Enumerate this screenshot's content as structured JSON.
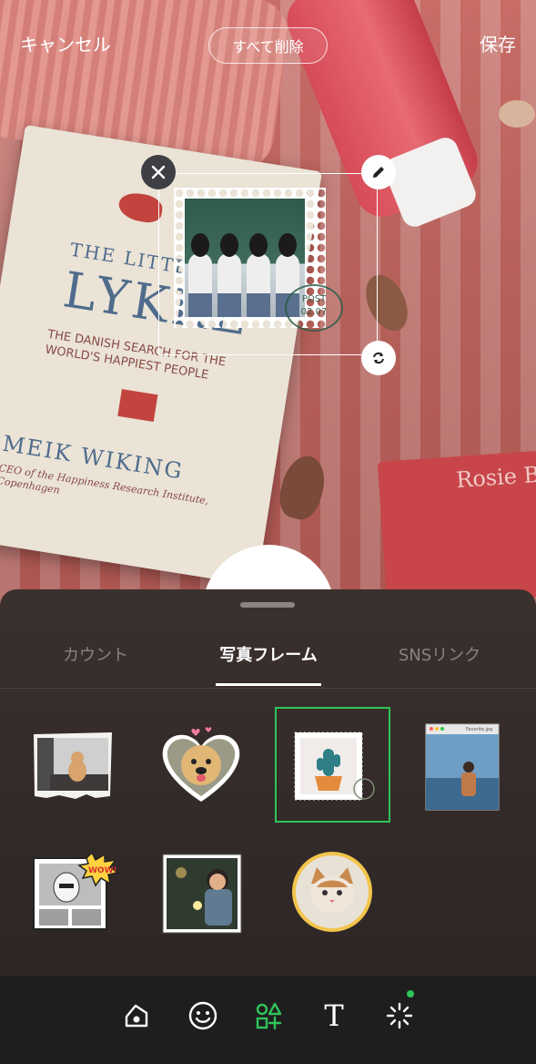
{
  "topbar": {
    "cancel_label": "キャンセル",
    "clear_all_label": "すべて削除",
    "save_label": "保存"
  },
  "background": {
    "book_title_small": "THE LITTLE",
    "book_title_large": "LYKKE",
    "book_subtitle": "THE DANISH SEARCH FOR THE WORLD'S HAPPIEST PEOPLE",
    "book_author": "MEIK WIKING",
    "book_author_note": "CEO of the Happiness Research Institute, Copenhagen",
    "book2_title": "Rosie B"
  },
  "sticker": {
    "postmark_text": "POST",
    "postmark_date": "02.07"
  },
  "tabs": [
    {
      "label": "カウント",
      "active": false
    },
    {
      "label": "写真フレーム",
      "active": true
    },
    {
      "label": "SNSリンク",
      "active": false
    }
  ],
  "frames": [
    {
      "name": "torn-paper-cat",
      "selected": false
    },
    {
      "name": "heart-dog",
      "selected": false
    },
    {
      "name": "stamp-cactus",
      "selected": true
    },
    {
      "name": "window-photo",
      "selected": false,
      "window_title": "Favorite.jpg"
    },
    {
      "name": "comic-wow",
      "selected": false,
      "burst_text": "WOW!"
    },
    {
      "name": "polaroid-boy",
      "selected": false
    },
    {
      "name": "circle-cat",
      "selected": false
    }
  ],
  "toolbar": [
    {
      "icon": "sticker-icon",
      "active": false
    },
    {
      "icon": "emoji-icon",
      "active": false
    },
    {
      "icon": "shapes-icon",
      "active": true
    },
    {
      "icon": "text-icon",
      "active": false,
      "glyph": "T"
    },
    {
      "icon": "effects-icon",
      "active": false,
      "badge": true
    }
  ],
  "colors": {
    "accent": "#2fc45a",
    "sheet_bg": "#2f2827",
    "toolbar_bg": "#1e1e1f"
  }
}
